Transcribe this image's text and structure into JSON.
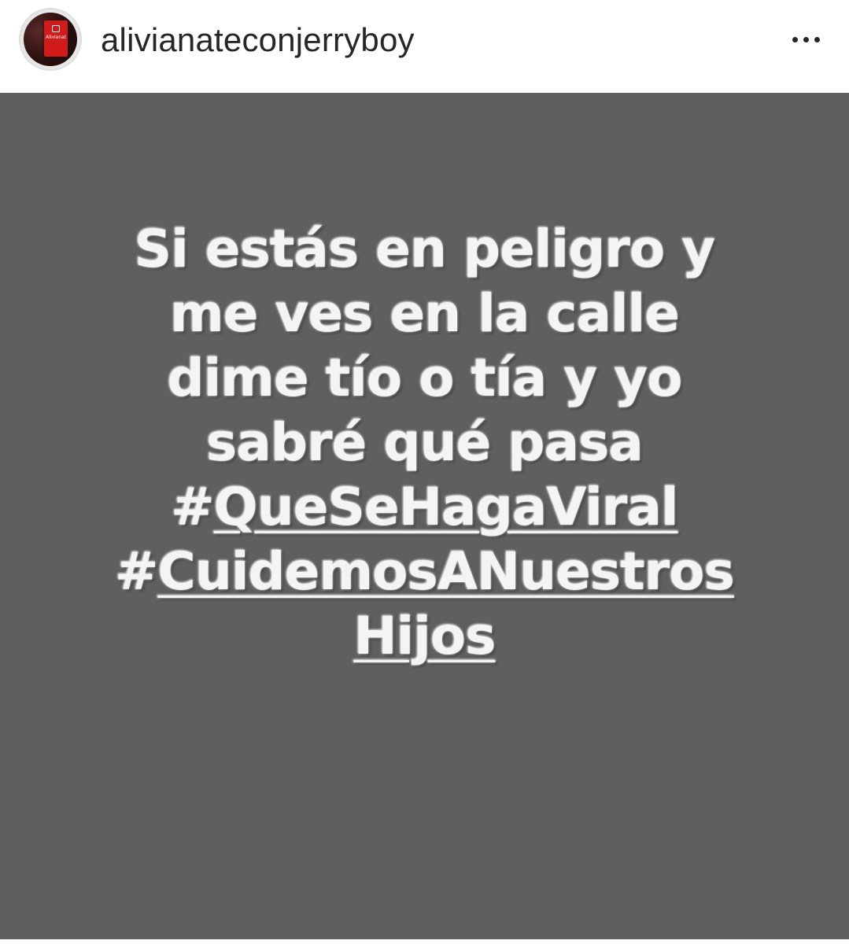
{
  "post": {
    "username": "alivianateconjerryboy",
    "avatar_logo_text": "Alivianate",
    "more_icon": "more-horizontal-icon",
    "image": {
      "background_color": "#5f5f5f",
      "text_color": "#f4f4f4",
      "lines": [
        "Si estás en peligro y",
        "me ves en la calle",
        "dime tío o tía  y yo",
        "sabré qué pasa"
      ],
      "hashtags": [
        {
          "symbol": "#",
          "text": "QueSeHagaViral"
        },
        {
          "symbol": "#",
          "text": "CuidemosANuestros"
        }
      ],
      "hashtag_continuation": "Hijos"
    }
  }
}
